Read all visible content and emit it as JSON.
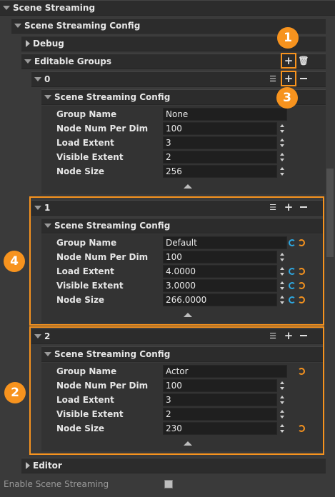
{
  "root": {
    "title": "Scene Streaming"
  },
  "config": {
    "title": "Scene Streaming Config"
  },
  "debug": {
    "title": "Debug"
  },
  "editable_groups": {
    "title": "Editable Groups"
  },
  "field_labels": {
    "group_name": "Group Name",
    "node_num": "Node Num Per Dim",
    "load_extent": "Load Extent",
    "visible_extent": "Visible Extent",
    "node_size": "Node Size"
  },
  "groups": [
    {
      "index": "0",
      "config_title": "Scene Streaming Config",
      "group_name": "None",
      "node_num": "100",
      "load_extent": "3",
      "visible_extent": "2",
      "node_size": "256"
    },
    {
      "index": "1",
      "config_title": "Scene Streaming Config",
      "group_name": "Default",
      "node_num": "100",
      "load_extent": "4.0000",
      "visible_extent": "3.0000",
      "node_size": "266.0000"
    },
    {
      "index": "2",
      "config_title": "Scene Streaming Config",
      "group_name": "Actor",
      "node_num": "100",
      "load_extent": "3",
      "visible_extent": "2",
      "node_size": "230"
    }
  ],
  "editor": {
    "title": "Editor"
  },
  "enable": {
    "label": "Enable Scene Streaming",
    "checked": true
  },
  "badges": [
    "1",
    "3",
    "4",
    "2"
  ],
  "colors": {
    "callout": "#f7931e",
    "reset_blue": "#2ea7e0"
  },
  "icons": [
    "add-icon",
    "delete-icon",
    "insert-icon",
    "remove-icon",
    "reset-icon",
    "collapse-up-icon"
  ]
}
